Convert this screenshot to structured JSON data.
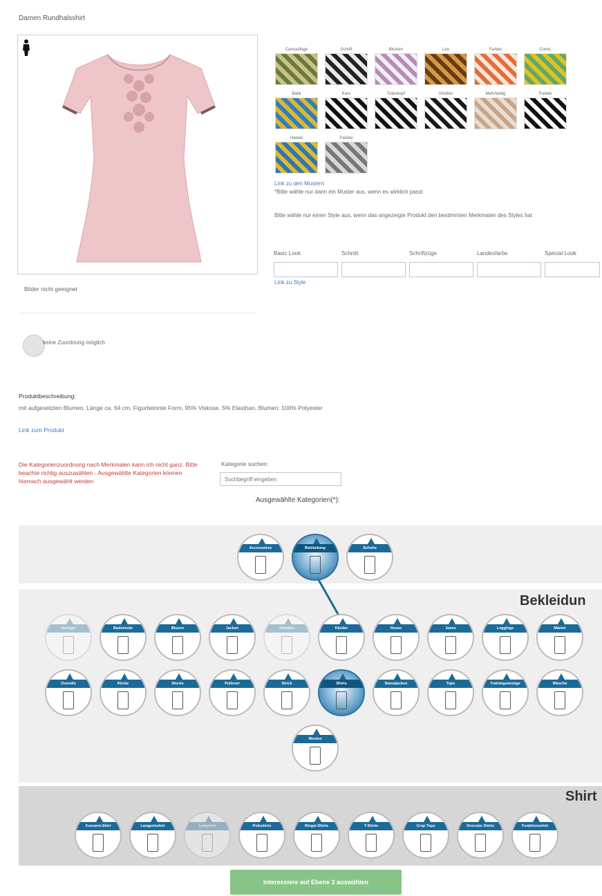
{
  "product": {
    "title": "Damen Rundhalsshirt",
    "no_image_label": "Bilder nicht geeignet",
    "drawing_label": "keine Zuordnung möglich",
    "desc_heading": "Produktbeschreibung:",
    "desc_text": "mit aufgesetzten Blumen, Länge ca. 64 cm, Figurbetonte Form, 95% Viskose, 5% Elasthan, Blumen: 100% Polyester",
    "link_label": "Link zum Produkt"
  },
  "patterns": {
    "items": [
      {
        "label": "Camouflage",
        "color_a": "#6b7a3a",
        "color_b": "#c9c08a"
      },
      {
        "label": "Schrift",
        "color_a": "#222222",
        "color_b": "#e8e8e8"
      },
      {
        "label": "Blumen",
        "color_a": "#b98ab6",
        "color_b": "#eef0f6"
      },
      {
        "label": "Leo",
        "color_a": "#6a3a12",
        "color_b": "#d19a44"
      },
      {
        "label": "Farben",
        "color_a": "#e86a3a",
        "color_b": "#f2e8d8"
      },
      {
        "label": "Comic",
        "color_a": "#e2c21e",
        "color_b": "#5ea86a"
      },
      {
        "label": "Batik",
        "color_a": "#2d7fbf",
        "color_b": "#e0b62e"
      },
      {
        "label": "Karo",
        "color_a": "#111111",
        "color_b": "#f4f4f4"
      },
      {
        "label": "Totenkopf",
        "color_a": "#111111",
        "color_b": "#f0f0f0"
      },
      {
        "label": "Streifen",
        "color_a": "#1a1a1a",
        "color_b": "#ffffff"
      },
      {
        "label": "Mehrfarbig",
        "color_a": "#c8a58a",
        "color_b": "#e8ddd2"
      },
      {
        "label": "Punkte",
        "color_a": "#111111",
        "color_b": "#ffffff"
      },
      {
        "label": "Hawaii",
        "color_a": "#2a78b8",
        "color_b": "#e3b829"
      },
      {
        "label": "Paisley",
        "color_a": "#777777",
        "color_b": "#d7d7d7"
      }
    ],
    "link_label": "Link zu den Mustern",
    "hint": "*Bitte wähle nur dann ein Muster aus, wenn es wirklich passt"
  },
  "styles": {
    "intro": "Bitte wähle nur einen Style aus, wenn das angezeigte Produkt den bestimmten Merkmalen des Styles hat",
    "columns": [
      "Basic Look",
      "Schnitt",
      "Schriftzüge",
      "Landesfarbe",
      "Special Look"
    ],
    "link_label": "Link zu Style"
  },
  "category_search": {
    "red_note": "Die Kategorienzuordnung nach Merkmalen kann ich nicht ganz. Bitte beachte richtig auszuwählen - Ausgewählte Kategorien können hiernach ausgewählt werden",
    "label": "Kategorie suchen:",
    "placeholder": "Suchbegriff eingeben",
    "selected_heading": "Ausgewählte Kategorien(*):"
  },
  "tree": {
    "top": [
      "Accessoires",
      "Bekleidung",
      "Schuhe"
    ],
    "bekleidung_title": "Bekleidun",
    "bekleidung_row1": [
      "Anzüge",
      "Bademode",
      "Blusen",
      "Jacken",
      "Hemden",
      "Kleider",
      "Hosen",
      "Jeans",
      "Leggings",
      "Mäntel"
    ],
    "bekleidung_row2": [
      "Overalls",
      "Röcke",
      "Shorts",
      "Pullover",
      "Strick",
      "Shirts",
      "Sweatjacken",
      "Tops",
      "Trainingsanzüge",
      "Wäsche"
    ],
    "bekleidung_row3": [
      "Westen"
    ],
    "shirts_title": "Shirt",
    "shirts_row": [
      "Kurzarm-Shirt",
      "Langarmshirt",
      "Longshirt",
      "Poloshirts",
      "Ringel-Shirts",
      "T-Shirts",
      "Crop Tops",
      "Oversize Shirts",
      "Funktionsshirt"
    ]
  },
  "cta_label": "Interessiere auf Ebene 3 auswählen"
}
